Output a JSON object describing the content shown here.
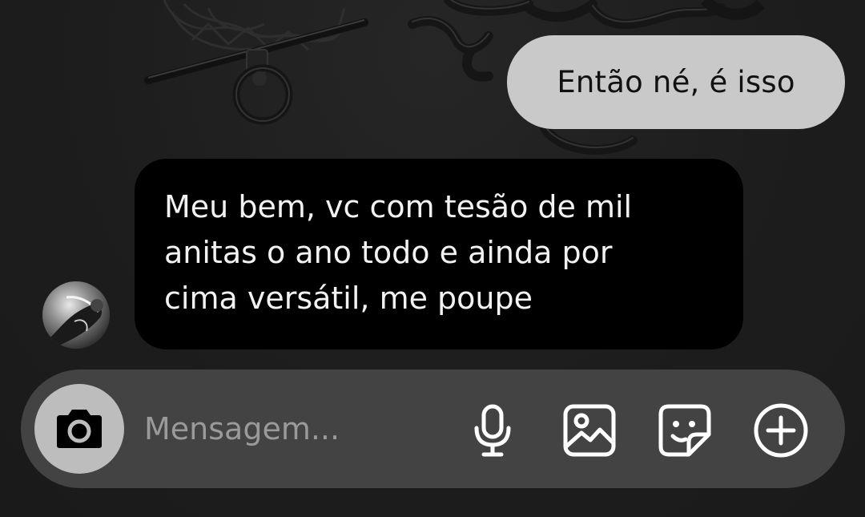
{
  "thread": {
    "messages": [
      {
        "direction": "outgoing",
        "text": "Então né, é isso"
      },
      {
        "direction": "incoming",
        "lines": [
          "Meu bem, vc com tesão de mil",
          "anitas o ano todo e ainda por",
          "cima versátil, me poupe"
        ],
        "avatar": "profile-photo"
      }
    ]
  },
  "composer": {
    "placeholder": "Mensagem...",
    "value": "",
    "icons": {
      "camera": "camera-icon",
      "mic": "microphone-icon",
      "gallery": "gallery-icon",
      "sticker": "sticker-icon",
      "more": "plus-circle-icon"
    }
  },
  "colors": {
    "background": "#1c1c1c",
    "outgoing_bubble": "#c9c9c9",
    "incoming_bubble": "#000000",
    "composer": "#434343",
    "camera_button": "#bdbdbd"
  }
}
